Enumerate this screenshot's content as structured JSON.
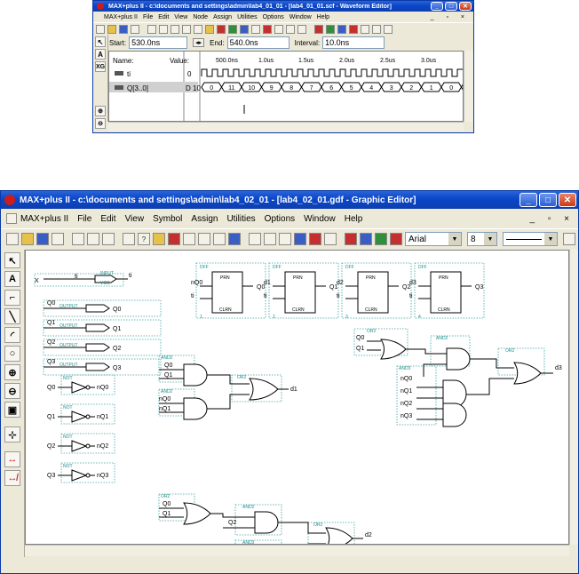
{
  "waveform_window": {
    "title": "MAX+plus II - c:\\documents and settings\\admin\\lab4_01_01 - [lab4_01_01.scf - Waveform Editor]",
    "menu": [
      "MAX+plus II",
      "File",
      "Edit",
      "View",
      "Node",
      "Assign",
      "Utilities",
      "Options",
      "Window",
      "Help"
    ],
    "start_label": "Start:",
    "start_value": "530.0ns",
    "end_label": "End:",
    "end_value": "540.0ns",
    "interval_label": "Interval:",
    "interval_value": "10.0ns",
    "time_ticks": [
      "500.0ns",
      "1.0us",
      "1.5us",
      "2.0us",
      "2.5us",
      "3.0us"
    ],
    "name_header": "Name:",
    "value_header": "Value:",
    "signals": [
      {
        "name": "ti",
        "value": "0"
      },
      {
        "name": "Q[3..0]",
        "value": "D 10"
      }
    ],
    "bus_values": [
      "0",
      "11",
      "10",
      "9",
      "8",
      "7",
      "6",
      "5",
      "4",
      "3",
      "2",
      "1",
      "0",
      "11",
      "10",
      "9",
      "8"
    ]
  },
  "graphic_window": {
    "title": "MAX+plus II - c:\\documents and settings\\admin\\lab4_02_01 - [lab4_02_01.gdf - Graphic Editor]",
    "menu": [
      "MAX+plus II",
      "File",
      "Edit",
      "View",
      "Symbol",
      "Assign",
      "Utilities",
      "Options",
      "Window",
      "Help"
    ],
    "font_name": "Arial",
    "font_size": "8",
    "schematic": {
      "input_pin": {
        "net": "X",
        "label": "ti",
        "tag": "INPUT",
        "vcc": "VCC",
        "out": "ti"
      },
      "output_pins": [
        {
          "net": "Q0",
          "tag": "OUTPUT",
          "out": "Q0"
        },
        {
          "net": "Q1",
          "tag": "OUTPUT",
          "out": "Q1"
        },
        {
          "net": "Q2",
          "tag": "OUTPUT",
          "out": "Q2"
        },
        {
          "net": "Q3",
          "tag": "OUTPUT",
          "out": "Q3"
        }
      ],
      "not_gates": [
        {
          "in": "Q0",
          "tag": "NOT",
          "out": "nQ0"
        },
        {
          "in": "Q1",
          "tag": "NOT",
          "out": "nQ1"
        },
        {
          "in": "Q2",
          "tag": "NOT",
          "out": "nQ2"
        },
        {
          "in": "Q3",
          "tag": "NOT",
          "out": "nQ3"
        }
      ],
      "flip_flops": [
        {
          "tag": "DFF",
          "d": "nQ0",
          "clk": "ti",
          "q": "Q0",
          "prn": "PRN",
          "clrn": "CLRN",
          "num": "1"
        },
        {
          "tag": "DFF",
          "d": "d1",
          "clk": "ti",
          "q": "Q1",
          "prn": "PRN",
          "clrn": "CLRN",
          "num": "2"
        },
        {
          "tag": "DFF",
          "d": "d2",
          "clk": "ti",
          "q": "Q2",
          "prn": "PRN",
          "clrn": "CLRN",
          "num": "3"
        },
        {
          "tag": "DFF",
          "d": "d3",
          "clk": "ti",
          "q": "Q3",
          "prn": "PRN",
          "clrn": "CLRN",
          "num": "4"
        }
      ],
      "gate_tags": {
        "and2": "AND2",
        "or2": "OR2",
        "and3": "AND3"
      },
      "net_labels": {
        "d1_inputs": [
          "Q0",
          "Q1",
          "nQ0",
          "nQ1"
        ],
        "d1_out": "d1",
        "d2_inputs": [
          "Q0",
          "Q1",
          "Q2",
          "nQ1",
          "Q2"
        ],
        "d2_out": "d2",
        "d3_inputs": [
          "Q0",
          "Q1",
          "nQ0",
          "nQ1",
          "nQ2",
          "nQ3"
        ],
        "d3_out": "d3"
      }
    }
  }
}
